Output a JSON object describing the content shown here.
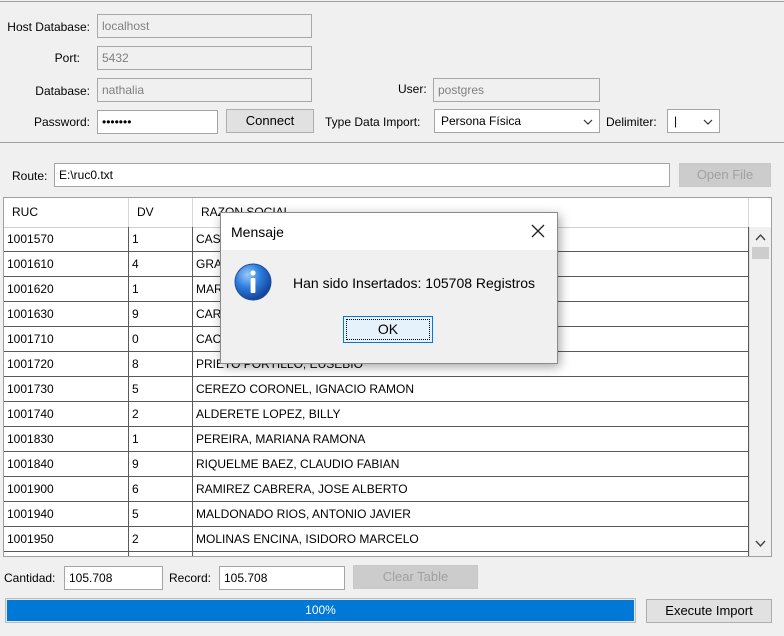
{
  "connection": {
    "host_label": "Host Database:",
    "host_value": "localhost",
    "port_label": "Port:",
    "port_value": "5432",
    "database_label": "Database:",
    "database_value": "nathalia",
    "user_label": "User:",
    "user_value": "postgres",
    "password_label": "Password:",
    "password_value": "•••••••",
    "connect_button": "Connect",
    "type_import_label": "Type Data Import:",
    "type_import_value": "Persona Física",
    "delimiter_label": "Delimiter:",
    "delimiter_value": "|"
  },
  "file": {
    "route_label": "Route:",
    "route_value": "E:\\ruc0.txt",
    "open_file_button": "Open File"
  },
  "table": {
    "columns": [
      "RUC",
      "DV",
      "RAZON SOCIAL"
    ],
    "rows": [
      [
        "1001570",
        "1",
        "CASTILLO"
      ],
      [
        "1001610",
        "4",
        "GRANADA"
      ],
      [
        "1001620",
        "1",
        "MARTINEZ"
      ],
      [
        "1001630",
        "9",
        "CARDOZO"
      ],
      [
        "1001710",
        "0",
        "CACERES"
      ],
      [
        "1001720",
        "8",
        "PRIETO PORTILLO, EUSEBIO"
      ],
      [
        "1001730",
        "5",
        "CEREZO CORONEL, IGNACIO RAMON"
      ],
      [
        "1001740",
        "2",
        "ALDERETE LOPEZ, BILLY"
      ],
      [
        "1001830",
        "1",
        "PEREIRA, MARIANA RAMONA"
      ],
      [
        "1001840",
        "9",
        "RIQUELME BAEZ, CLAUDIO FABIAN"
      ],
      [
        "1001900",
        "6",
        "RAMIREZ CABRERA, JOSE ALBERTO"
      ],
      [
        "1001940",
        "5",
        "MALDONADO RIOS, ANTONIO JAVIER"
      ],
      [
        "1001950",
        "2",
        "MOLINAS ENCINA, ISIDORO MARCELO"
      ],
      [
        "",
        "",
        ""
      ]
    ]
  },
  "footer": {
    "cantidad_label": "Cantidad:",
    "cantidad_value": "105.708",
    "record_label": "Record:",
    "record_value": "105.708",
    "clear_table_button": "Clear Table",
    "progress_text": "100%",
    "progress_fraction": 1.0,
    "execute_button": "Execute Import"
  },
  "dialog": {
    "title": "Mensaje",
    "message": "Han sido Insertados: 105708 Registros",
    "ok_button": "OK"
  },
  "colors": {
    "accent": "#0078d7",
    "info_icon": "#1d6fd1"
  }
}
